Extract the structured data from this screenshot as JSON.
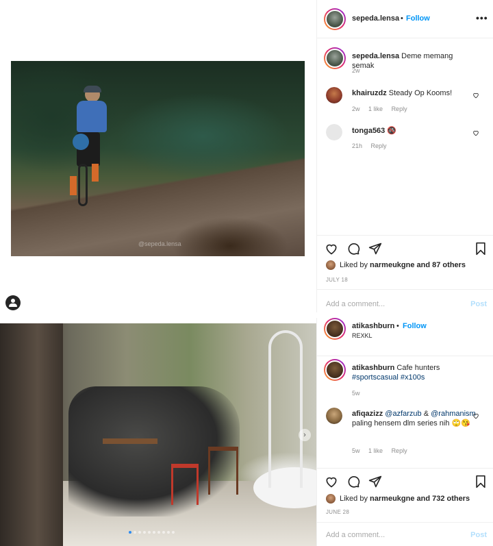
{
  "posts": [
    {
      "username": "sepeda.lensa",
      "follow_label": "Follow",
      "sep": "•",
      "more_label": "•••",
      "watermark": "@sepeda.lensa",
      "caption": {
        "user": "sepeda.lensa",
        "text": "Deme memang semak",
        "age": "2w"
      },
      "comments": [
        {
          "user": "khairuzdz",
          "text": "Steady Op Kooms!",
          "age": "2w",
          "likes": "1 like",
          "reply": "Reply"
        },
        {
          "user": "tonga563",
          "text": "🚳",
          "age": "21h",
          "likes": "",
          "reply": "Reply"
        }
      ],
      "liked_by_prefix": "Liked by",
      "liked_by_user": "narmeukgne",
      "liked_by_suffix": "and 87 others",
      "date": "JULY 18",
      "add_comment_placeholder": "Add a comment...",
      "post_label": "Post"
    },
    {
      "username": "atikashburn",
      "follow_label": "Follow",
      "sep": "•",
      "location": "REXKL",
      "caption": {
        "user": "atikashburn",
        "text": "Cafe hunters",
        "tags": "#sportscasual #x100s",
        "age": "5w"
      },
      "comments": [
        {
          "user": "afiqazizz",
          "mention1": "@azfarzub",
          "amp": "&",
          "mention2": "@rahmanism",
          "text": "paling hensem dlm series nih 🙄😘",
          "age": "5w",
          "likes": "1 like",
          "reply": "Reply"
        }
      ],
      "carousel_next": "›",
      "liked_by_prefix": "Liked by",
      "liked_by_user": "narmeukgne",
      "liked_by_suffix": "and 732 others",
      "date": "JUNE 28",
      "add_comment_placeholder": "Add a comment...",
      "post_label": "Post"
    }
  ],
  "colors": {
    "accent": "#0095f6",
    "post_disabled": "#b2dffc",
    "muted": "#8e8e8e",
    "border": "#efefef"
  },
  "icons": [
    "heart-icon",
    "comment-icon",
    "share-icon",
    "save-icon",
    "profile-icon",
    "more-icon",
    "chevron-right-icon"
  ]
}
